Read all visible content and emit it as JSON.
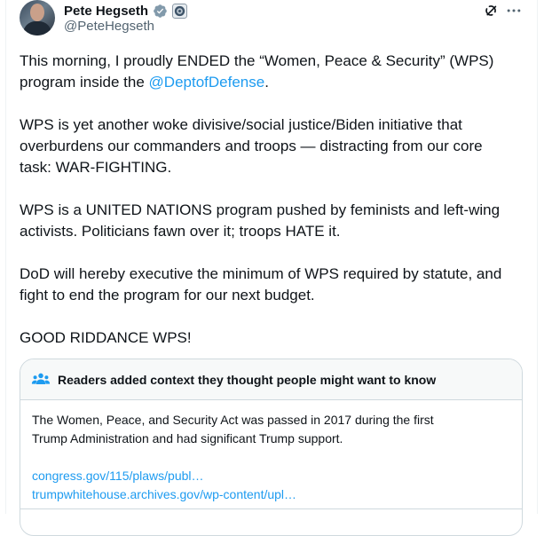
{
  "author": {
    "name": "Pete Hegseth",
    "handle": "@PeteHegseth",
    "verified_color": "#829aab"
  },
  "tweet": {
    "line1": {
      "before": "This morning, I proudly ENDED the “Women, Peace & Security” (WPS)",
      "line2_prefix": "program inside the ",
      "mention": "@DeptofDefense",
      "after": "."
    },
    "para2": [
      "WPS is yet another woke divisive/social justice/Biden initiative that",
      "overburdens our commanders and troops — distracting from our core",
      "task: WAR-FIGHTING."
    ],
    "para3": [
      "WPS is a UNITED NATIONS program pushed by feminists and left-wing",
      "activists. Politicians fawn over it; troops HATE it."
    ],
    "para4": [
      "DoD will hereby executive the minimum of WPS required by statute, and",
      "fight to end the program for our next budget."
    ],
    "para5": "GOOD RIDDANCE WPS!"
  },
  "community_note": {
    "title": "Readers added context they thought people might want to know",
    "body": [
      "The Women, Peace, and Security Act was passed in 2017 during the first",
      "Trump Administration and had significant Trump support."
    ],
    "links": [
      "congress.gov/115/plaws/publ…",
      "trumpwhitehouse.archives.gov/wp-content/upl…"
    ]
  },
  "colors": {
    "accent": "#1d9bf0",
    "secondary_text": "#536471",
    "note_header_bg": "#f7f9f9",
    "note_icon": "#1d9bf0"
  }
}
